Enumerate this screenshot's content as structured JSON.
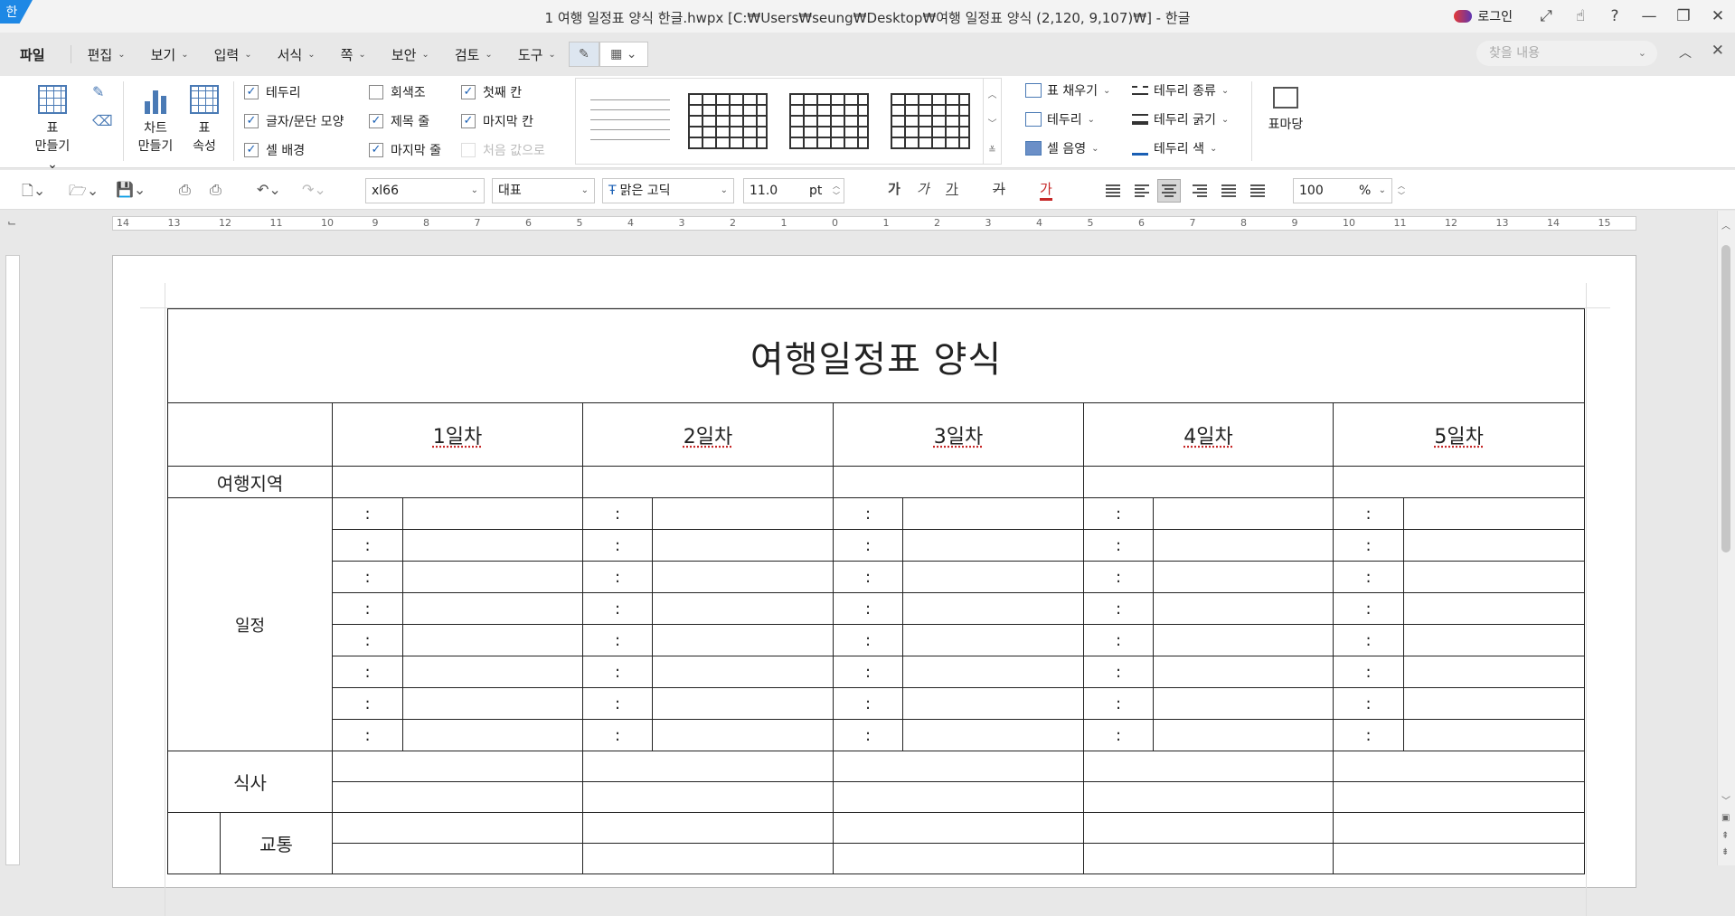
{
  "titlebar": {
    "app_badge": "한",
    "title": "1 여행 일정표 양식 한글.hwpx [C:₩Users₩seung₩Desktop₩여행 일정표 양식 (2,120, 9,107)₩] - 한글",
    "login": "로그인",
    "icons": [
      "expand-icon",
      "hand-icon",
      "help-icon",
      "minimize-icon",
      "restore-icon",
      "close-icon"
    ]
  },
  "menu": {
    "file": "파일",
    "items": [
      "편집",
      "보기",
      "입력",
      "서식",
      "쪽",
      "보안",
      "검토",
      "도구"
    ],
    "search_placeholder": "찾을 내용"
  },
  "ribbon": {
    "table_make": [
      "표",
      "만들기"
    ],
    "chart_make": [
      "차트",
      "만들기"
    ],
    "table_props": [
      "표",
      "속성"
    ],
    "checks": [
      {
        "label": "테두리",
        "checked": true
      },
      {
        "label": "회색조",
        "checked": false
      },
      {
        "label": "첫째 칸",
        "checked": true
      },
      {
        "label": "글자/문단 모양",
        "checked": true
      },
      {
        "label": "제목 줄",
        "checked": true
      },
      {
        "label": "마지막 칸",
        "checked": true
      },
      {
        "label": "셀 배경",
        "checked": true
      },
      {
        "label": "마지막 줄",
        "checked": true
      },
      {
        "label": "처음 값으로",
        "checked": false,
        "disabled": true
      }
    ],
    "fill": "표 채우기",
    "border": "테두리",
    "cell_shade": "셀 음영",
    "border_type": "테두리 종류",
    "border_width": "테두리 굵기",
    "border_color": "테두리 색",
    "table_wizard": "표마당"
  },
  "toolbar": {
    "style": "xl66",
    "font_lang": "대표",
    "font": "맑은 고딕",
    "font_size": "11.0",
    "unit": "pt",
    "bold": "가",
    "italic": "가",
    "underline": "가",
    "strike": "가",
    "color_text": "가",
    "zoom": "100",
    "zoom_unit": "%"
  },
  "ruler": {
    "labels": [
      "14",
      "13",
      "12",
      "11",
      "10",
      "9",
      "8",
      "7",
      "6",
      "5",
      "4",
      "3",
      "2",
      "1",
      "0",
      "1",
      "2",
      "3",
      "4",
      "5",
      "6",
      "7",
      "8",
      "9",
      "10",
      "11",
      "12",
      "13",
      "14",
      "15"
    ]
  },
  "doc": {
    "title": "여행일정표  양식",
    "days": [
      "1일차",
      "2일차",
      "3일차",
      "4일차",
      "5일차"
    ],
    "row_region": "여행지역",
    "row_schedule": "일정",
    "row_meal": "식사",
    "row_transport": "교통",
    "time_colon": ":"
  }
}
